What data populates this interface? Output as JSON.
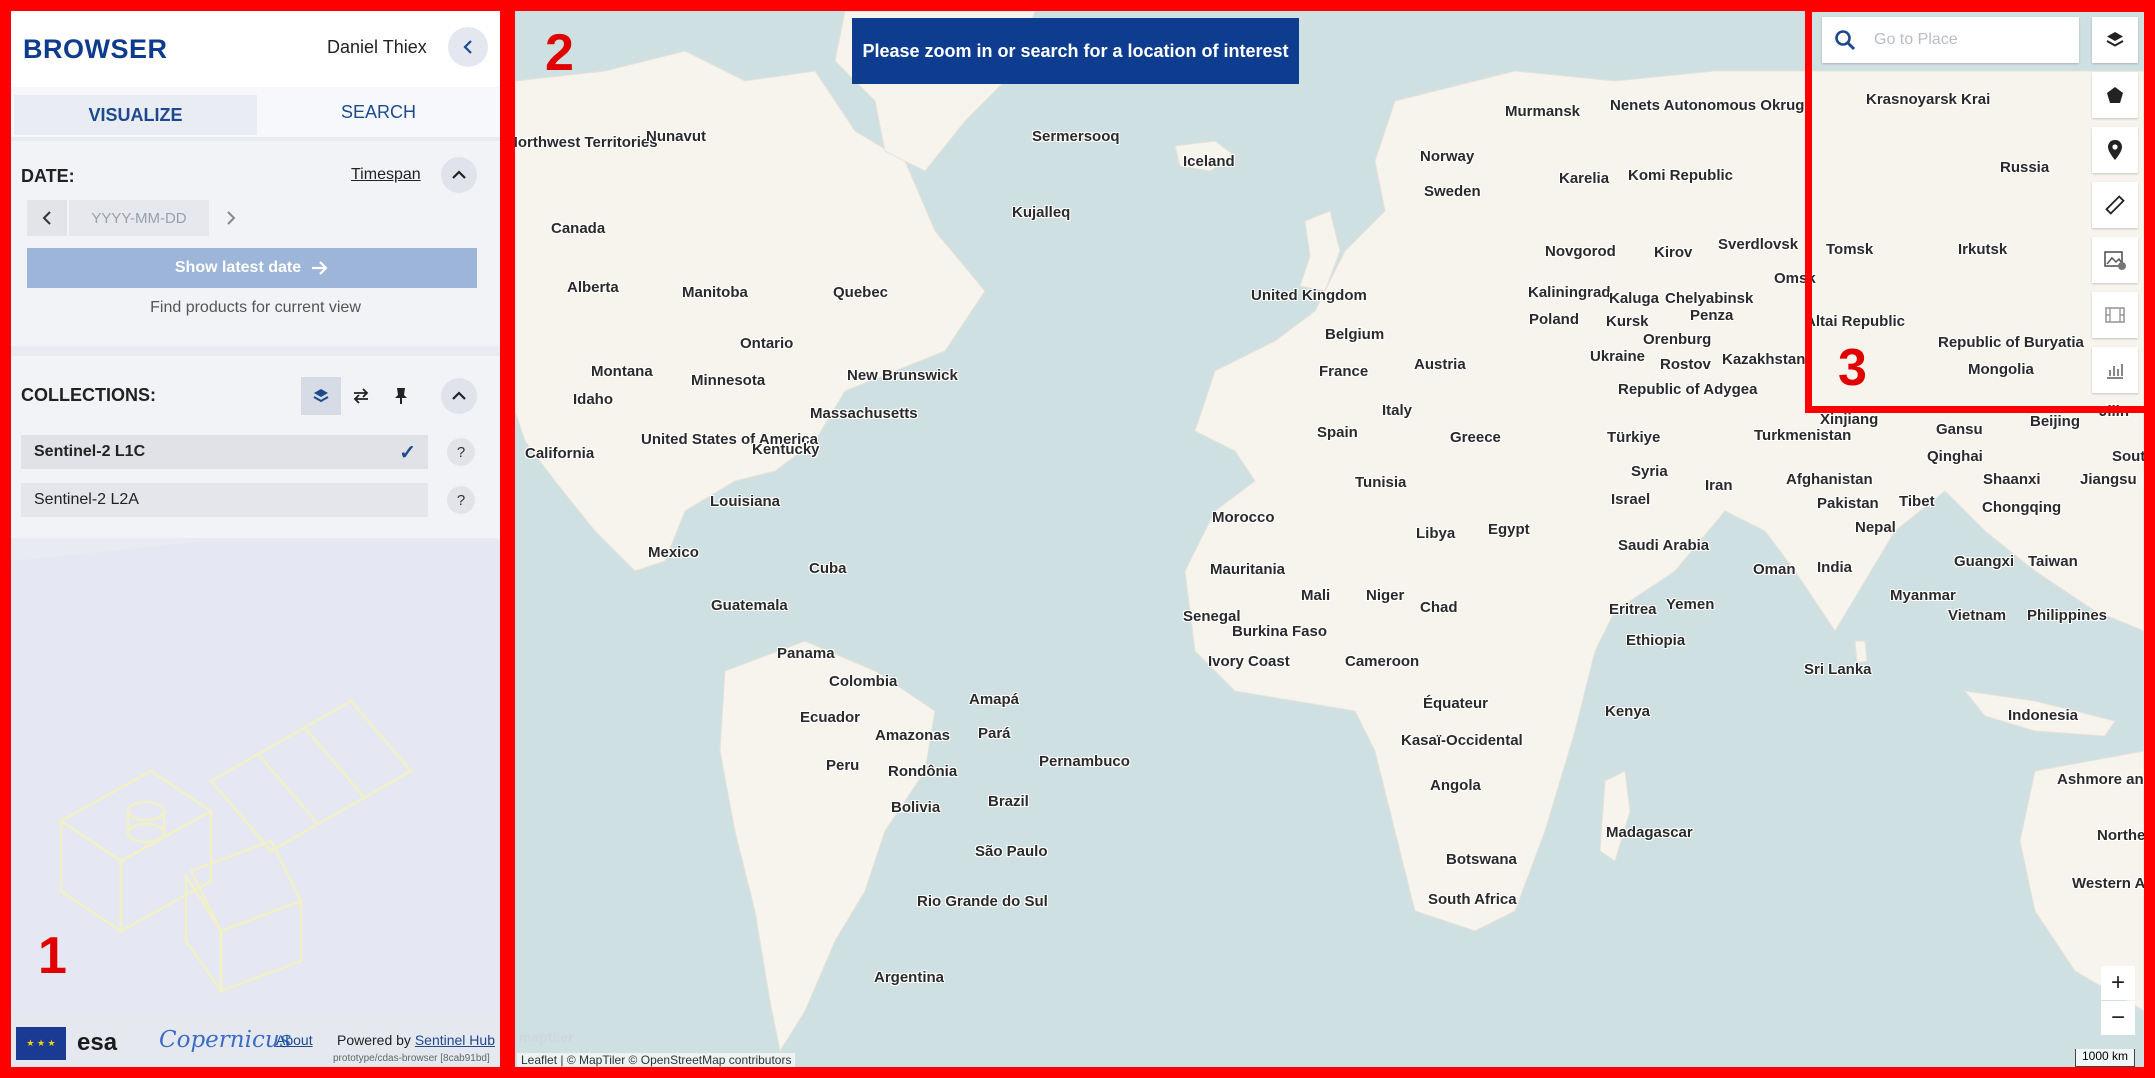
{
  "sidebar": {
    "brand": "BROWSER",
    "user": "Daniel Thiex",
    "tabs": [
      "VISUALIZE",
      "SEARCH"
    ],
    "date": {
      "label": "DATE:",
      "timespan": "Timespan",
      "placeholder": "YYYY-MM-DD",
      "latest_button": "Show latest date",
      "find_products": "Find products for current view"
    },
    "collections": {
      "label": "COLLECTIONS:",
      "items": [
        {
          "name": "Sentinel-2 L1C",
          "selected": true
        },
        {
          "name": "Sentinel-2 L2A",
          "selected": false
        }
      ],
      "help": "?"
    },
    "footer": {
      "esa": "esa",
      "copernicus": "opernicus",
      "about": "About",
      "powered_by": "Powered by",
      "sentinel_hub": "Sentinel Hub",
      "version": "prototype/cdas-browser [8cab91bd]"
    }
  },
  "box_numbers": [
    "1",
    "2",
    "3"
  ],
  "map": {
    "banner": "Please zoom in or search for a location of interest",
    "search_placeholder": "Go to Place",
    "attribution": "Leaflet | © MapTiler © OpenStreetMap contributors",
    "scale": "1000 km",
    "watermark": "maptiler",
    "zoom_in": "+",
    "zoom_out": "−",
    "labels": [
      "Northwest Territories",
      "Nunavut",
      "Sermersooq",
      "Iceland",
      "Kujalleq",
      "Canada",
      "Alberta",
      "Manitoba",
      "Quebec",
      "Ontario",
      "Montana",
      "Minnesota",
      "New Brunswick",
      "Idaho",
      "Massachusetts",
      "California",
      "United States of America",
      "Kentucky",
      "Louisiana",
      "Mexico",
      "Cuba",
      "Guatemala",
      "Panama",
      "Colombia",
      "Ecuador",
      "Amapá",
      "Pará",
      "Amazonas",
      "Pernambuco",
      "Peru",
      "Rondônia",
      "Bolivia",
      "Brazil",
      "São Paulo",
      "Rio Grande do Sul",
      "Argentina",
      "Murmansk",
      "Nenets Autonomous Okrug",
      "Norway",
      "Karelia",
      "Sweden",
      "Komi Republic",
      "Novgorod",
      "Kirov",
      "Sverdlovsk",
      "United Kingdom",
      "Kaliningrad",
      "Kaluga",
      "Chelyabinsk",
      "Belgium",
      "Poland",
      "Kursk",
      "Penza",
      "Orenburg",
      "France",
      "Austria",
      "Ukraine",
      "Rostov",
      "Kazakhstan",
      "Republic of Adygea",
      "Italy",
      "Spain",
      "Greece",
      "Türkiye",
      "Turkmenistan",
      "Tunisia",
      "Syria",
      "Afghanistan",
      "Iran",
      "Israel",
      "Pakistan",
      "Morocco",
      "Libya",
      "Egypt",
      "Saudi Arabia",
      "Oman",
      "Mauritania",
      "Mali",
      "Niger",
      "Chad",
      "Eritrea",
      "Yemen",
      "Senegal",
      "Burkina Faso",
      "Ethiopia",
      "Ivory Coast",
      "Cameroon",
      "Équateur",
      "Kenya",
      "Kasaï-Occidental",
      "Angola",
      "Madagascar",
      "Botswana",
      "South Africa",
      "Krasnoyarsk Krai",
      "Russia",
      "Tomsk",
      "Irkutsk",
      "Altai Republic",
      "Republic of Buryatia",
      "Mongolia",
      "Xinjiang",
      "Gansu",
      "Beijing",
      "Qinghai",
      "South Korea",
      "Shaanxi",
      "Jiangsu",
      "Tibet",
      "Chongqing",
      "Nepal",
      "India",
      "Guangxi",
      "Taiwan",
      "Myanmar",
      "Vietnam",
      "Philippines",
      "Sri Lanka",
      "Indonesia",
      "Ashmore and Cartier Islands",
      "Northern Territory",
      "Western Australia",
      "Omsk",
      "Jilin"
    ]
  },
  "tools": [
    "layers-icon",
    "polygon-icon",
    "pin-icon",
    "ruler-icon",
    "image-download-icon",
    "film-icon",
    "chart-icon"
  ]
}
